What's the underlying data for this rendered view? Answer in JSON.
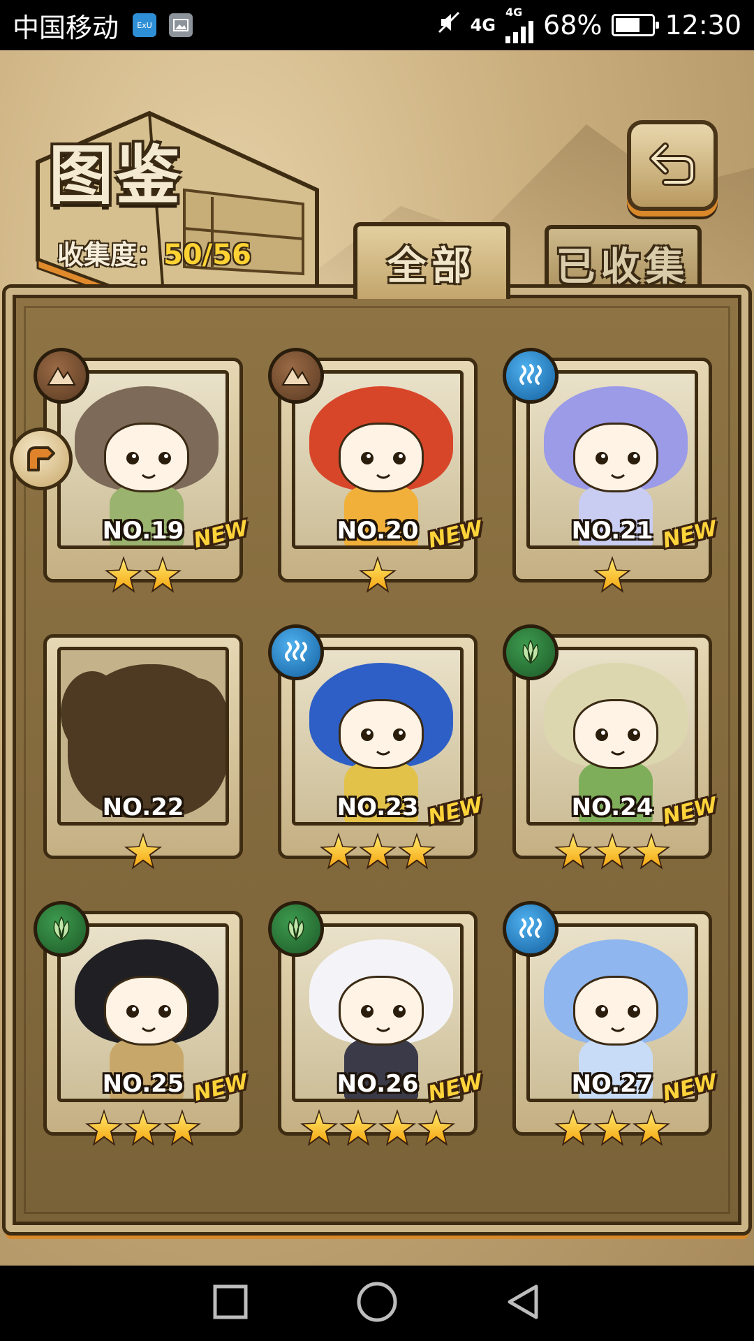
{
  "status_bar": {
    "carrier": "中国移动",
    "app_icons": [
      "blue-app-icon",
      "gallery-icon"
    ],
    "net_primary": "4G",
    "net_secondary": "4G",
    "battery_text": "68%",
    "battery_level": 0.68,
    "time": "12:30"
  },
  "header": {
    "title": "图鉴",
    "collection_label": "收集度：",
    "collection_value": "50/56",
    "back_icon": "return-arrow-icon"
  },
  "tabs": [
    {
      "label": "全部",
      "active": true
    },
    {
      "label": "已收集",
      "active": false
    }
  ],
  "cards": [
    {
      "number": "NO.19",
      "element": "earth",
      "stars": 2,
      "new": true,
      "hair": "#7d6a58",
      "body": "#9ab36e",
      "locked": false
    },
    {
      "number": "NO.20",
      "element": "earth",
      "stars": 1,
      "new": true,
      "hair": "#d8462a",
      "body": "#f0b03a",
      "locked": false
    },
    {
      "number": "NO.21",
      "element": "water",
      "stars": 1,
      "new": true,
      "hair": "#9b9be8",
      "body": "#c9cdf2",
      "locked": false
    },
    {
      "number": "NO.22",
      "element": "",
      "stars": 1,
      "new": false,
      "hair": "",
      "body": "",
      "locked": true
    },
    {
      "number": "NO.23",
      "element": "water",
      "stars": 3,
      "new": true,
      "hair": "#2e5fc6",
      "body": "#e3c24a",
      "locked": false
    },
    {
      "number": "NO.24",
      "element": "leaf",
      "stars": 3,
      "new": true,
      "hair": "#ddd7b0",
      "body": "#7fae5a",
      "locked": false
    },
    {
      "number": "NO.25",
      "element": "leaf",
      "stars": 3,
      "new": true,
      "hair": "#1f1f24",
      "body": "#c8a86a",
      "locked": false
    },
    {
      "number": "NO.26",
      "element": "leaf",
      "stars": 4,
      "new": true,
      "hair": "#f4f4f8",
      "body": "#3a3a48",
      "locked": false
    },
    {
      "number": "NO.27",
      "element": "water",
      "stars": 3,
      "new": true,
      "hair": "#8fb6ef",
      "body": "#c8dcf8",
      "locked": false
    }
  ],
  "new_label": "NEW",
  "side_nav_icon": "page-arrow-icon",
  "nav_bar": {
    "buttons": [
      "recent-apps-icon",
      "home-icon",
      "back-icon"
    ]
  }
}
